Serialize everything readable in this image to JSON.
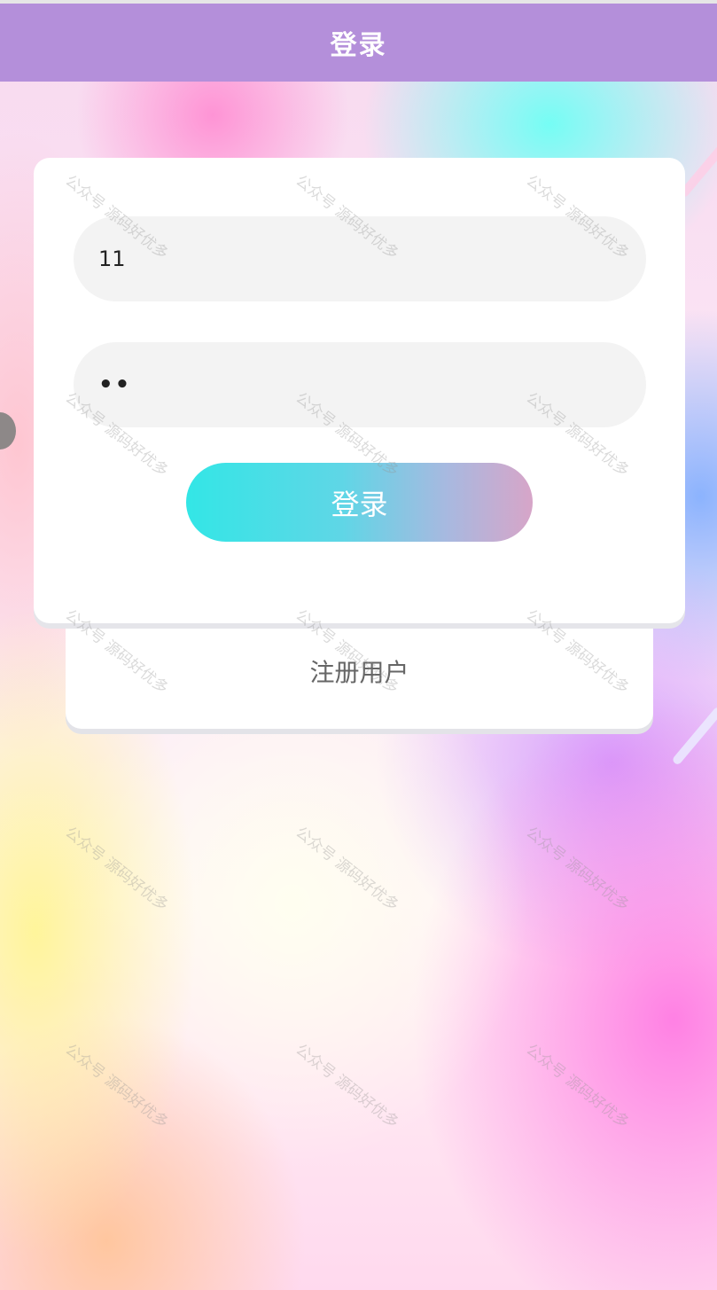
{
  "header": {
    "title": "登录"
  },
  "login_form": {
    "username_value": "11",
    "password_mask": "••",
    "submit_label": "登录"
  },
  "register": {
    "link_label": "注册用户"
  },
  "watermark": {
    "text": "公众号 源码好优多"
  },
  "colors": {
    "header_bg": "#b48fda",
    "button_gradient_start": "#33e6e6",
    "button_gradient_end": "#d7a5c8",
    "input_bg": "#f3f3f3"
  }
}
